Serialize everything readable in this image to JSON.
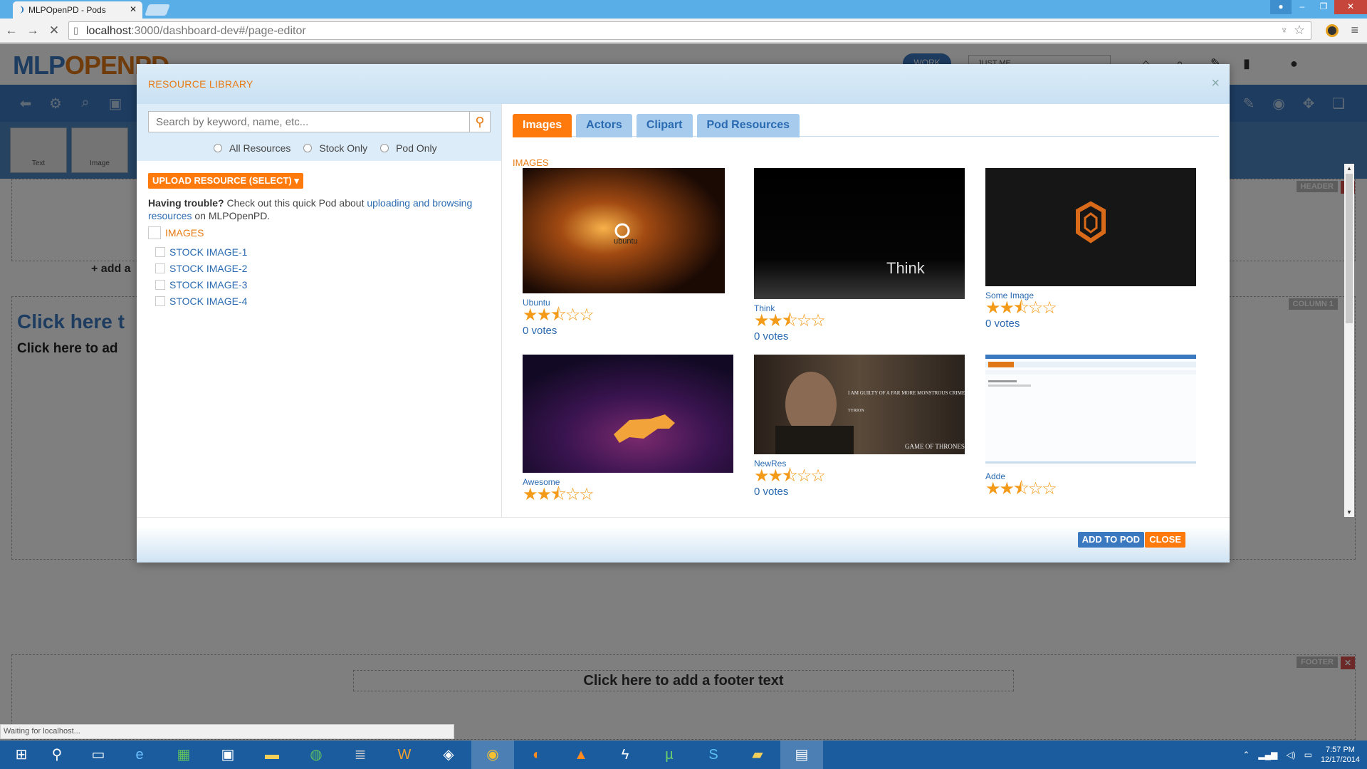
{
  "browser": {
    "tab_title": "MLPOpenPD - Pods",
    "tab_close": "✕",
    "url_host": "localhost",
    "url_rest": ":3000/dashboard-dev#/page-editor",
    "status_text": "Waiting for localhost..."
  },
  "app": {
    "logo_a": "MLP",
    "logo_b": "OPENPD",
    "work_label": "WORK",
    "just_me": "JUST ME",
    "widget_text": "Text",
    "widget_image": "Image",
    "header_tag": "HEADER",
    "column_tag": "COLUMN 1",
    "footer_tag": "FOOTER",
    "add_a": "+ add a",
    "click_big": "Click here t",
    "click_med": "Click here to ad",
    "footer_text": "Click here to add a footer text"
  },
  "modal": {
    "title": "RESOURCE LIBRARY",
    "close_x": "×",
    "search_placeholder": "Search by keyword, name, etc...",
    "radios": [
      "All Resources",
      "Stock Only",
      "Pod Only"
    ],
    "upload_label": "UPLOAD RESOURCE (SELECT)",
    "help_bold": "Having trouble?",
    "help_pre": " Check out this quick Pod about ",
    "help_link": "uploading and browsing resources",
    "help_post": " on MLPOpenPD.",
    "tree_root": "IMAGES",
    "tree_items": [
      "STOCK IMAGE-1",
      "STOCK IMAGE-2",
      "STOCK IMAGE-3",
      "STOCK IMAGE-4"
    ],
    "tabs": [
      "Images",
      "Actors",
      "Clipart",
      "Pod Resources"
    ],
    "section_label": "IMAGES",
    "cards": [
      {
        "name": "Ubuntu",
        "votes": "0 votes",
        "rating": 2.5,
        "thumb_text": "ubuntu"
      },
      {
        "name": "Think",
        "votes": "0 votes",
        "rating": 2.5,
        "thumb_text": "Think"
      },
      {
        "name": "Some Image",
        "votes": "0 votes",
        "rating": 2.5,
        "thumb_text": ""
      },
      {
        "name": "Awesome",
        "votes": "",
        "rating": 2.5,
        "thumb_text": ""
      },
      {
        "name": "NewRes",
        "votes": "0 votes",
        "rating": 2.5,
        "thumb_text": "GAME OF THRONES",
        "quote": "I AM GUILTY OF A FAR MORE MONSTROUS CRIME. I AM GUILTY OF BEING A DWARF.",
        "quote_by": "TYRION"
      },
      {
        "name": "Adde",
        "votes": "",
        "rating": 2.5,
        "thumb_text": ""
      }
    ],
    "add_to_pod": "ADD TO POD",
    "close_label": "CLOSE"
  },
  "taskbar": {
    "time": "7:57 PM",
    "date": "12/17/2014"
  },
  "colors": {
    "accent_orange": "#ff7a0c",
    "accent_blue": "#3a78c0",
    "star": "#f39a18"
  }
}
